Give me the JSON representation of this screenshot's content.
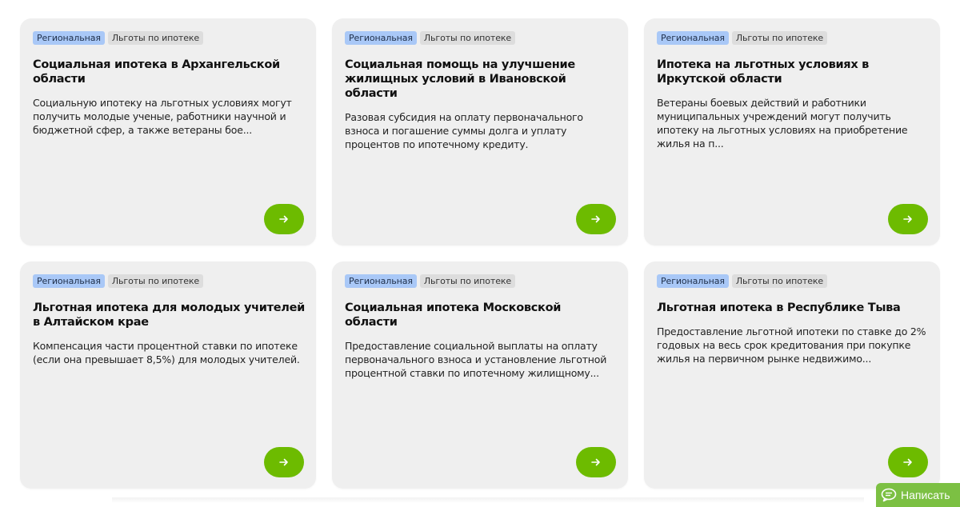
{
  "cards": [
    {
      "tags": [
        "Региональная",
        "Льготы по ипотеке"
      ],
      "title": "Социальная ипотека в Архангельской области",
      "description": "Социальную ипотеку на льготных условиях могут получить молодые ученые, работники научной и бюджетной сфер, а также ветераны бое..."
    },
    {
      "tags": [
        "Региональная",
        "Льготы по ипотеке"
      ],
      "title": "Социальная помощь на улучшение жилищных условий в Ивановской области",
      "description": "Разовая субсидия на оплату первоначального взноса и погашение суммы долга и уплату процентов по ипотечному кредиту."
    },
    {
      "tags": [
        "Региональная",
        "Льготы по ипотеке"
      ],
      "title": "Ипотека на льготных условиях в Иркутской области",
      "description": "Ветераны боевых действий и работники муниципальных учреждений могут получить ипотеку на льготных условиях на приобретение жилья на п..."
    },
    {
      "tags": [
        "Региональная",
        "Льготы по ипотеке"
      ],
      "title": "Льготная ипотека для молодых учителей в Алтайском крае",
      "description": "Компенсация части процентной ставки по ипотеке (если она превышает 8,5%) для молодых учителей."
    },
    {
      "tags": [
        "Региональная",
        "Льготы по ипотеке"
      ],
      "title": "Социальная ипотека Московской области",
      "description": "Предоставление социальной выплаты на оплату первоначального взноса и установление льготной процентной ставки по ипотечному жилищному..."
    },
    {
      "tags": [
        "Региональная",
        "Льготы по ипотеке"
      ],
      "title": "Льготная ипотека в Республике Тыва",
      "description": "Предоставление льготной ипотеки по ставке до 2% годовых на весь срок кредитования при покупке жилья на первичном рынке недвижимо..."
    }
  ],
  "card_button_icon": "arrow-right-icon",
  "chat": {
    "label": "Написать",
    "icon": "chat-bubble-icon"
  },
  "colors": {
    "card_bg": "#efefef",
    "tag_regional_bg": "#a9c8f7",
    "tag_benefit_bg": "#dddddd",
    "accent_green": "#6dbb00",
    "chat_green": "#7cc043"
  }
}
